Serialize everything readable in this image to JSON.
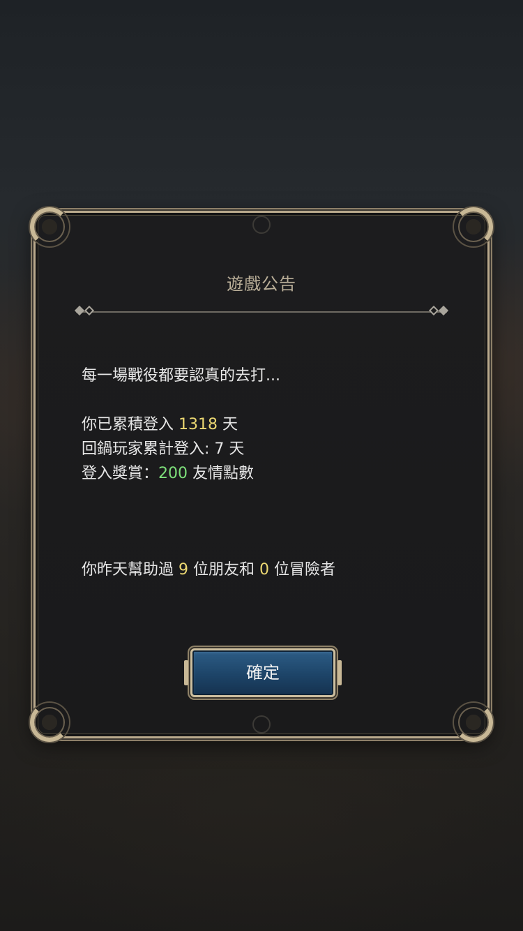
{
  "dialog": {
    "title": "遊戲公告",
    "message": "每一場戰役都要認真的去打...",
    "stats": {
      "days_prefix": "你已累積登入 ",
      "days_value": "1318",
      "days_suffix": " 天",
      "return_line": "回鍋玩家累計登入: 7 天",
      "reward_prefix": "登入獎賞：",
      "reward_value": "200",
      "reward_suffix": " 友情點數"
    },
    "help": {
      "prefix": "你昨天幫助過 ",
      "friends_value": "9",
      "middle": " 位朋友和 ",
      "adventurers_value": "0",
      "suffix": " 位冒險者"
    },
    "confirm_label": "確定"
  },
  "colors": {
    "highlight_yellow": "#ecd872",
    "highlight_green": "#7ee07a",
    "title_color": "#b9ae98",
    "button_blue": "#1d4468",
    "frame_gold": "#c8b896"
  }
}
